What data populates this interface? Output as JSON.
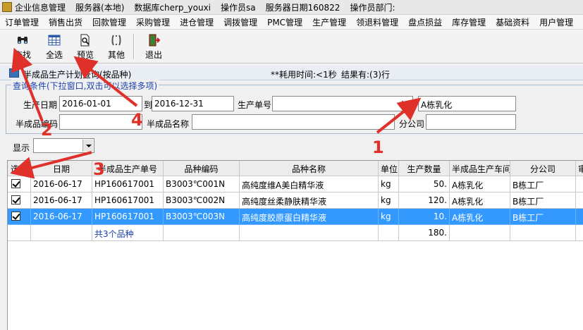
{
  "titlebar": {
    "app_name": "企业信息管理",
    "server": "服务器(本地)",
    "database": "数据库cherp_youxi",
    "operator": "操作员sa",
    "server_date": "服务器日期160822",
    "operator_dept": "操作员部门:"
  },
  "menu": [
    "订单管理",
    "销售出货",
    "回款管理",
    "采购管理",
    "进仓管理",
    "调拨管理",
    "PMC管理",
    "生产管理",
    "领退料管理",
    "盘点损益",
    "库存管理",
    "基础资料",
    "用户管理"
  ],
  "toolbar": {
    "search": "查找",
    "select_all": "全选",
    "preview": "预览",
    "other": "其他",
    "exit": "退出"
  },
  "window": {
    "title": "半成品生产计划查询(按品种)",
    "elapsed": "**耗用时间:<1秒",
    "result": "结果有:(3)行"
  },
  "query": {
    "legend": "查询条件(下拉窗口,双击可以选择多项)",
    "prod_date_label": "生产日期",
    "date_from": "2016-01-01",
    "to_label": "到",
    "date_to": "2016-12-31",
    "order_no_label": "生产单号",
    "order_no": "",
    "workshop_label": "车间",
    "workshop": "A栋乳化",
    "semi_code_label": "半成品编码",
    "semi_code": "",
    "semi_name_label": "半成品名称",
    "semi_name": "",
    "branch_label": "分公司",
    "branch": "",
    "display_label": "显示",
    "display_value": ""
  },
  "grid": {
    "headers": [
      "选中",
      "日期",
      "半成品生产单号",
      "品种编码",
      "品种名称",
      "单位",
      "生产数量",
      "半成品生产车间",
      "分公司",
      "审"
    ],
    "rows": [
      {
        "date": "2016-06-17",
        "order": "HP160617001",
        "code": "B3003℃001N",
        "name": "高纯度维A美白精华液",
        "unit": "kg",
        "qty": "50.",
        "workshop": "A栋乳化",
        "branch": "B栋工厂"
      },
      {
        "date": "2016-06-17",
        "order": "HP160617001",
        "code": "B3003℃002N",
        "name": "高纯度丝柔静肤精华液",
        "unit": "kg",
        "qty": "120.",
        "workshop": "A栋乳化",
        "branch": "B栋工厂"
      },
      {
        "date": "2016-06-17",
        "order": "HP160617001",
        "code": "B3003℃003N",
        "name": "高纯度胶原蛋白精华液",
        "unit": "kg",
        "qty": "10.",
        "workshop": "A栋乳化",
        "branch": "B栋工厂"
      }
    ],
    "summary_label": "共3个品种",
    "summary_qty": "180."
  },
  "annotations": [
    "1",
    "2",
    "3",
    "4"
  ],
  "colors": {
    "annotation": "#e0302a",
    "selection": "#3399ff",
    "legend": "#1a3fb0"
  }
}
